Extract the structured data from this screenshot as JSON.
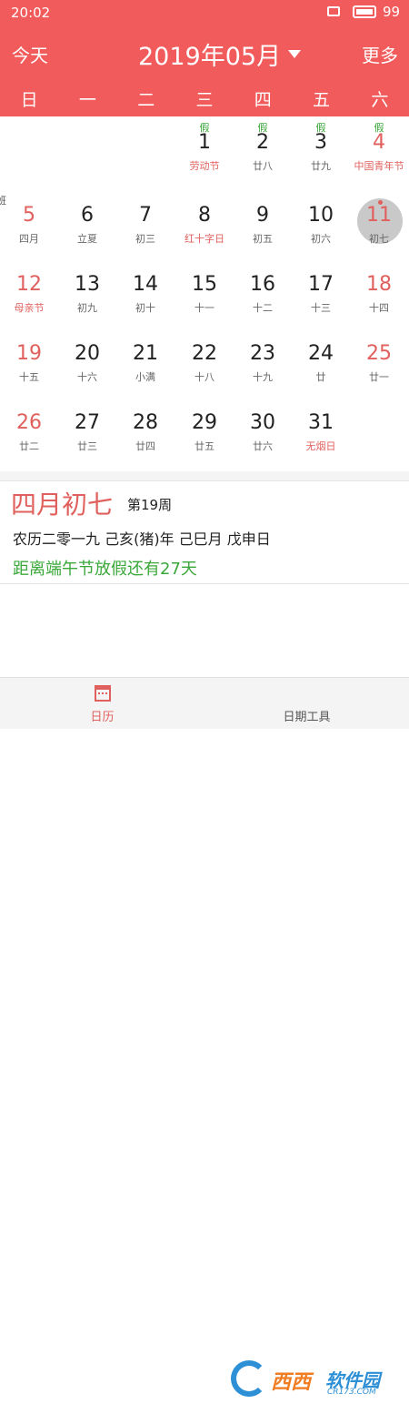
{
  "status_bar": {
    "time": "20:02",
    "battery": "99"
  },
  "header": {
    "today_label": "今天",
    "month_title": "2019年05月",
    "more_label": "更多"
  },
  "weekdays": [
    "日",
    "一",
    "二",
    "三",
    "四",
    "五",
    "六"
  ],
  "calendar": {
    "rows": [
      [
        {
          "num": "",
          "sub": "",
          "tag": ""
        },
        {
          "num": "",
          "sub": "",
          "tag": ""
        },
        {
          "num": "",
          "sub": "",
          "tag": ""
        },
        {
          "num": "1",
          "sub": "劳动节",
          "tag": "假"
        },
        {
          "num": "2",
          "sub": "廿八",
          "tag": "假"
        },
        {
          "num": "3",
          "sub": "廿九",
          "tag": "假"
        },
        {
          "num": "4",
          "sub": "中国青年节",
          "tag": "假"
        }
      ],
      [
        {
          "num": "5",
          "sub": "四月",
          "tag": "班"
        },
        {
          "num": "6",
          "sub": "立夏",
          "tag": ""
        },
        {
          "num": "7",
          "sub": "初三",
          "tag": ""
        },
        {
          "num": "8",
          "sub": "红十字日",
          "tag": ""
        },
        {
          "num": "9",
          "sub": "初五",
          "tag": ""
        },
        {
          "num": "10",
          "sub": "初六",
          "tag": ""
        },
        {
          "num": "11",
          "sub": "初七",
          "tag": ""
        }
      ],
      [
        {
          "num": "12",
          "sub": "母亲节",
          "tag": ""
        },
        {
          "num": "13",
          "sub": "初九",
          "tag": ""
        },
        {
          "num": "14",
          "sub": "初十",
          "tag": ""
        },
        {
          "num": "15",
          "sub": "十一",
          "tag": ""
        },
        {
          "num": "16",
          "sub": "十二",
          "tag": ""
        },
        {
          "num": "17",
          "sub": "十三",
          "tag": ""
        },
        {
          "num": "18",
          "sub": "十四",
          "tag": ""
        }
      ],
      [
        {
          "num": "19",
          "sub": "十五",
          "tag": ""
        },
        {
          "num": "20",
          "sub": "十六",
          "tag": ""
        },
        {
          "num": "21",
          "sub": "小满",
          "tag": ""
        },
        {
          "num": "22",
          "sub": "十八",
          "tag": ""
        },
        {
          "num": "23",
          "sub": "十九",
          "tag": ""
        },
        {
          "num": "24",
          "sub": "廿",
          "tag": ""
        },
        {
          "num": "25",
          "sub": "廿一",
          "tag": ""
        }
      ],
      [
        {
          "num": "26",
          "sub": "廿二",
          "tag": ""
        },
        {
          "num": "27",
          "sub": "廿三",
          "tag": ""
        },
        {
          "num": "28",
          "sub": "廿四",
          "tag": ""
        },
        {
          "num": "29",
          "sub": "廿五",
          "tag": ""
        },
        {
          "num": "30",
          "sub": "廿六",
          "tag": ""
        },
        {
          "num": "31",
          "sub": "无烟日",
          "tag": ""
        },
        {
          "num": "",
          "sub": "",
          "tag": ""
        }
      ]
    ],
    "red_subs": [
      "劳动节",
      "中国青年节",
      "红十字日",
      "母亲节",
      "无烟日"
    ],
    "selected": "11"
  },
  "info": {
    "lunar_date": "四月初七",
    "week": "第19周",
    "ganzhi": "农历二零一九 己亥(猪)年 己巳月 戊申日",
    "countdown": "距离端午节放假还有27天"
  },
  "tabs": [
    {
      "label": "日历",
      "icon": "calendar-icon"
    },
    {
      "label": "日期工具",
      "icon": "tools-icon"
    }
  ],
  "watermark": {
    "text1": "西西",
    "text2": "软件园",
    "url": "CR173.COM"
  },
  "colors": {
    "accent": "#f25b5b",
    "holiday_tag": "#3aa83a",
    "red_text": "#e0605e"
  }
}
